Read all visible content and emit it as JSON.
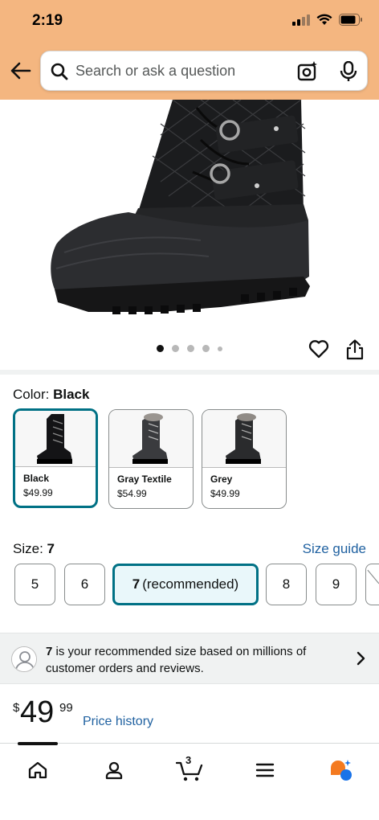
{
  "status_bar": {
    "time": "2:19"
  },
  "search": {
    "placeholder": "Search or ask a question"
  },
  "image_carousel": {
    "total": 5,
    "active_index": 0
  },
  "color": {
    "label": "Color:",
    "selected": "Black",
    "options": [
      {
        "name": "Black",
        "price": "$49.99"
      },
      {
        "name": "Gray Textile",
        "price": "$54.99"
      },
      {
        "name": "Grey",
        "price": "$49.99"
      }
    ]
  },
  "size": {
    "label": "Size:",
    "selected": "7",
    "guide_label": "Size guide",
    "options": [
      "5",
      "6",
      "7",
      "8",
      "9"
    ],
    "recommended_suffix": "(recommended)"
  },
  "recommendation": {
    "size": "7",
    "text": "is your recommended size based on millions of customer orders and reviews."
  },
  "price": {
    "symbol": "$",
    "whole": "49",
    "fraction": "99",
    "history_label": "Price history"
  },
  "nav": {
    "cart_count": "3",
    "items": [
      "home-icon",
      "account-icon",
      "cart-icon",
      "menu-icon",
      "rufus-icon"
    ]
  },
  "colors": {
    "header_bg": "#f4b680",
    "selected_border": "#007185",
    "link": "#2162a1"
  }
}
